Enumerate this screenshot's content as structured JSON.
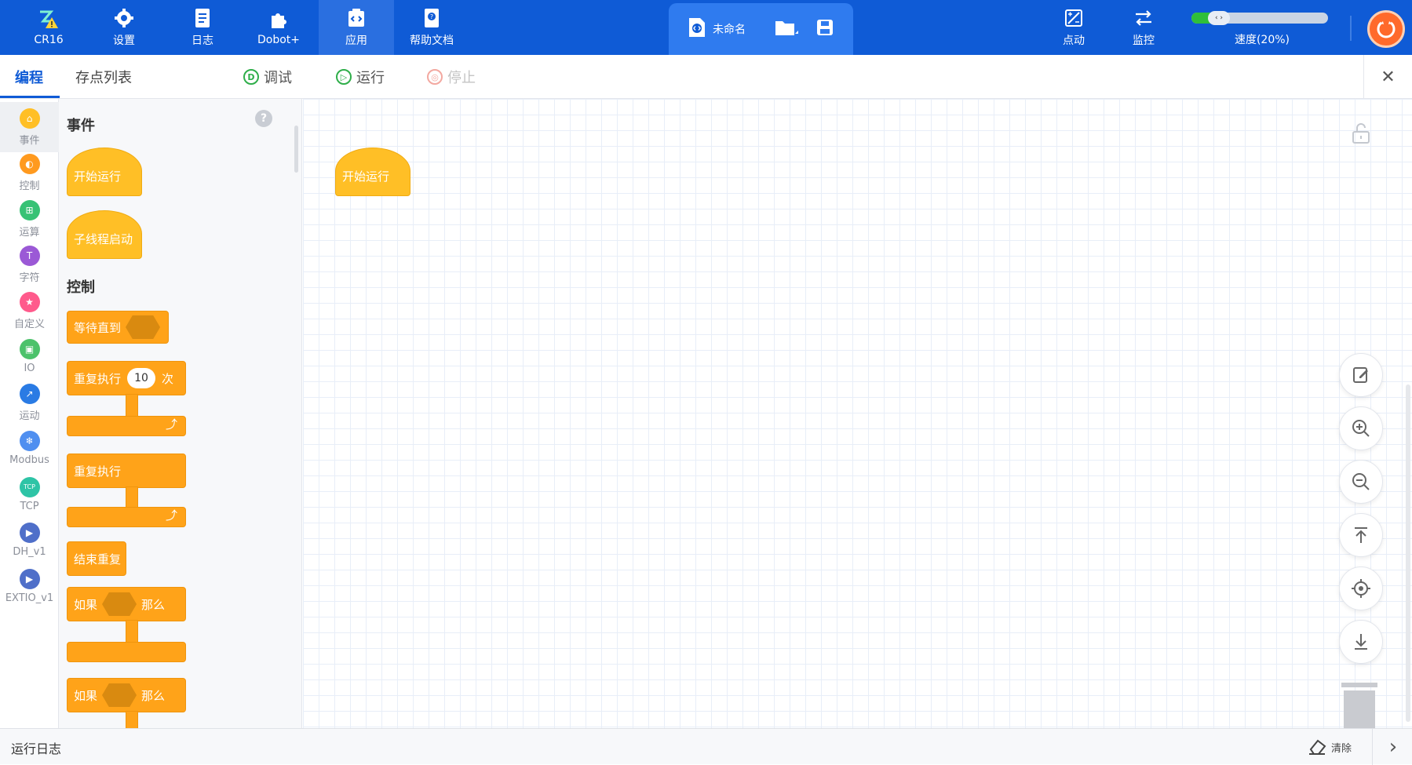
{
  "colors": {
    "primary": "#0f5bd6",
    "event_block": "#ffbf26",
    "control_block": "#ffa319",
    "speed_fill": "#2fbf3a",
    "emergency": "#ff6a2b"
  },
  "topbar": {
    "items": [
      {
        "label": "CR16",
        "icon": "robot-warning-icon"
      },
      {
        "label": "设置",
        "icon": "gear-icon"
      },
      {
        "label": "日志",
        "icon": "log-icon"
      },
      {
        "label": "Dobot+",
        "icon": "puzzle-icon"
      },
      {
        "label": "应用",
        "icon": "app-code-icon",
        "active": true
      },
      {
        "label": "帮助文档",
        "icon": "help-doc-icon"
      }
    ],
    "document": {
      "name": "未命名",
      "icon": "script-file-icon",
      "folder_icon": "folder-icon",
      "save_icon": "save-icon"
    },
    "jog_label": "点动",
    "monitor_label": "监控",
    "speed": {
      "label": "速度(20%)",
      "percent": 20
    },
    "emergency_icon": "emergency-stop-icon"
  },
  "subbar": {
    "tabs": [
      {
        "label": "编程",
        "active": true
      },
      {
        "label": "存点列表",
        "active": false
      }
    ],
    "debug": {
      "label": "调试",
      "icon_letter": "D"
    },
    "run": {
      "label": "运行",
      "icon_letter": "▷"
    },
    "stop": {
      "label": "停止",
      "icon_letter": "◎"
    }
  },
  "categories": [
    {
      "label": "事件",
      "color": "#ffbf26",
      "glyph": "⌂",
      "active": true
    },
    {
      "label": "控制",
      "color": "#ff9a1f",
      "glyph": "◐"
    },
    {
      "label": "运算",
      "color": "#37c275",
      "glyph": "⊞"
    },
    {
      "label": "字符",
      "color": "#9b59d6",
      "glyph": "T"
    },
    {
      "label": "自定义",
      "color": "#ff5a8c",
      "glyph": "★"
    },
    {
      "label": "IO",
      "color": "#4cc26b",
      "glyph": "▣"
    },
    {
      "label": "运动",
      "color": "#2a7be4",
      "glyph": "↗"
    },
    {
      "label": "Modbus",
      "color": "#4f8ff0",
      "glyph": "❄"
    },
    {
      "label": "TCP",
      "color": "#2ec4a6",
      "glyph": "TCP"
    },
    {
      "label": "DH_v1",
      "color": "#4f6fc9",
      "glyph": "▶"
    },
    {
      "label": "EXTIO_v1",
      "color": "#4f6fc9",
      "glyph": "▶"
    }
  ],
  "flyout": {
    "events_heading": "事件",
    "control_heading": "控制",
    "blocks": {
      "start_run": "开始运行",
      "subthread_start": "子线程启动",
      "wait_until": "等待直到",
      "repeat_prefix": "重复执行",
      "repeat_count": "10",
      "repeat_suffix": "次",
      "repeat_forever": "重复执行",
      "break_repeat": "结束重复",
      "if_label": "如果",
      "then_label": "那么"
    }
  },
  "canvas": {
    "start_block": "开始运行",
    "tools": [
      "edit-icon",
      "zoom-in-icon",
      "zoom-out-icon",
      "scroll-to-top-icon",
      "center-icon",
      "scroll-to-bottom-icon"
    ]
  },
  "logbar": {
    "title": "运行日志",
    "clear": "清除"
  }
}
